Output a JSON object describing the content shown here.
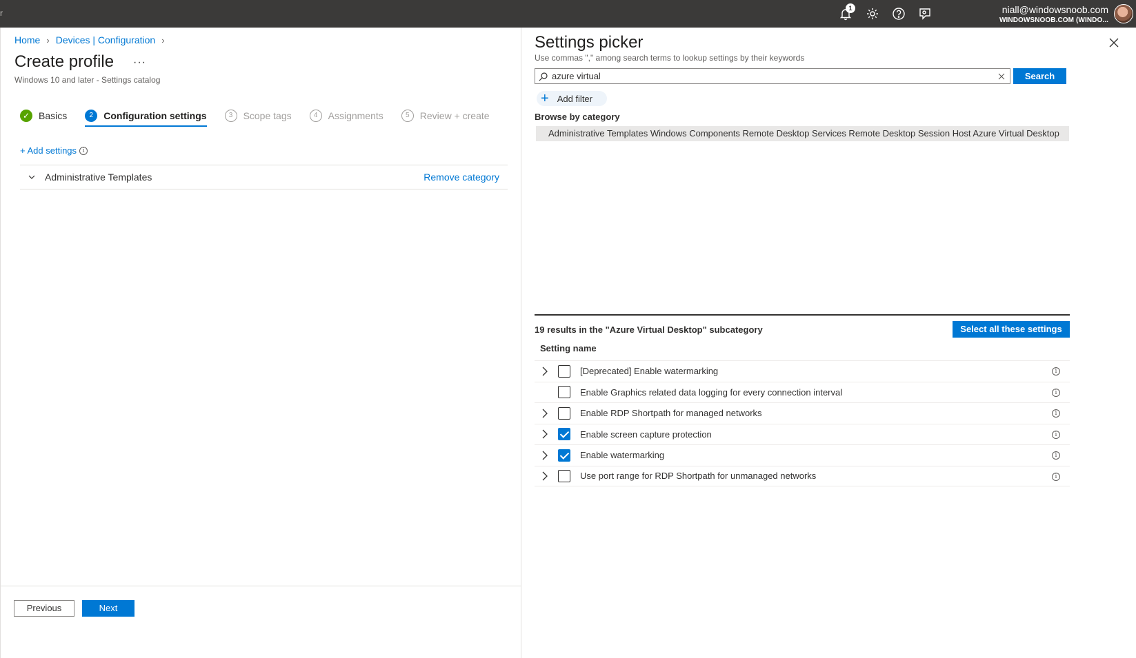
{
  "topbar": {
    "edge_glyph": "r",
    "notification_count": "1",
    "account_email": "niall@windowsnoob.com",
    "account_tenant": "WINDOWSNOOB.COM (WINDO..."
  },
  "breadcrumb": {
    "items": [
      "Home",
      "Devices | Configuration"
    ]
  },
  "page": {
    "title": "Create profile",
    "more": "···",
    "subtitle": "Windows 10 and later - Settings catalog"
  },
  "steps": [
    {
      "num": "✓",
      "label": "Basics",
      "state": "done"
    },
    {
      "num": "2",
      "label": "Configuration settings",
      "state": "active"
    },
    {
      "num": "3",
      "label": "Scope tags",
      "state": "pending"
    },
    {
      "num": "4",
      "label": "Assignments",
      "state": "pending"
    },
    {
      "num": "5",
      "label": "Review + create",
      "state": "pending"
    }
  ],
  "config": {
    "add_settings": "+ Add settings",
    "category_name": "Administrative Templates",
    "remove_category": "Remove category"
  },
  "footer": {
    "previous": "Previous",
    "next": "Next"
  },
  "picker": {
    "title": "Settings picker",
    "hint": "Use commas \",\" among search terms to lookup settings by their keywords",
    "search_value": "azure virtual",
    "search_button": "Search",
    "add_filter": "Add filter",
    "browse_label": "Browse by category",
    "category_path": "Administrative Templates Windows Components Remote Desktop Services Remote Desktop Session Host Azure Virtual Desktop",
    "results_label": "19 results in the \"Azure Virtual Desktop\" subcategory",
    "select_all": "Select all these settings",
    "column_header": "Setting name",
    "results": [
      {
        "label": "[Deprecated] Enable watermarking",
        "checked": false,
        "expandable": true
      },
      {
        "label": "Enable Graphics related data logging for every connection interval",
        "checked": false,
        "expandable": false
      },
      {
        "label": "Enable RDP Shortpath for managed networks",
        "checked": false,
        "expandable": true
      },
      {
        "label": "Enable screen capture protection",
        "checked": true,
        "expandable": true
      },
      {
        "label": "Enable watermarking",
        "checked": true,
        "expandable": true
      },
      {
        "label": "Use port range for RDP Shortpath for unmanaged networks",
        "checked": false,
        "expandable": true
      }
    ]
  },
  "colors": {
    "accent": "#0078d4",
    "topbar": "#3b3a39",
    "success": "#57a300"
  }
}
